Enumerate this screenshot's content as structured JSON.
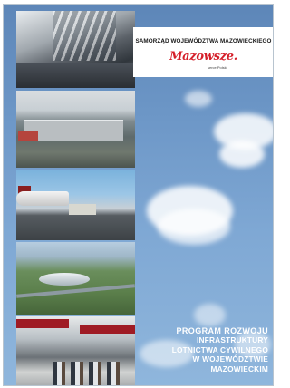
{
  "header": {
    "region_name": "SAMORZĄD WOJEWÓDZTWA MAZOWIECKIEGO",
    "logo_text": "Mazowsze.",
    "logo_subtitle": "serce Polski"
  },
  "photos": [
    {
      "subject": "airport terminal interior"
    },
    {
      "subject": "aerial view of airport terminal"
    },
    {
      "subject": "aircraft on apron"
    },
    {
      "subject": "aerial view of regional airport"
    },
    {
      "subject": "terminal check-in hall"
    }
  ],
  "title_lines": [
    "Program rozwoju",
    "infrastruktury",
    "lotnictwa cywilnego",
    "w województwie",
    "mazowieckim"
  ],
  "colors": {
    "sky": "#7fa8d4",
    "logo_red": "#d51f2a",
    "title_text": "#ffffff"
  }
}
